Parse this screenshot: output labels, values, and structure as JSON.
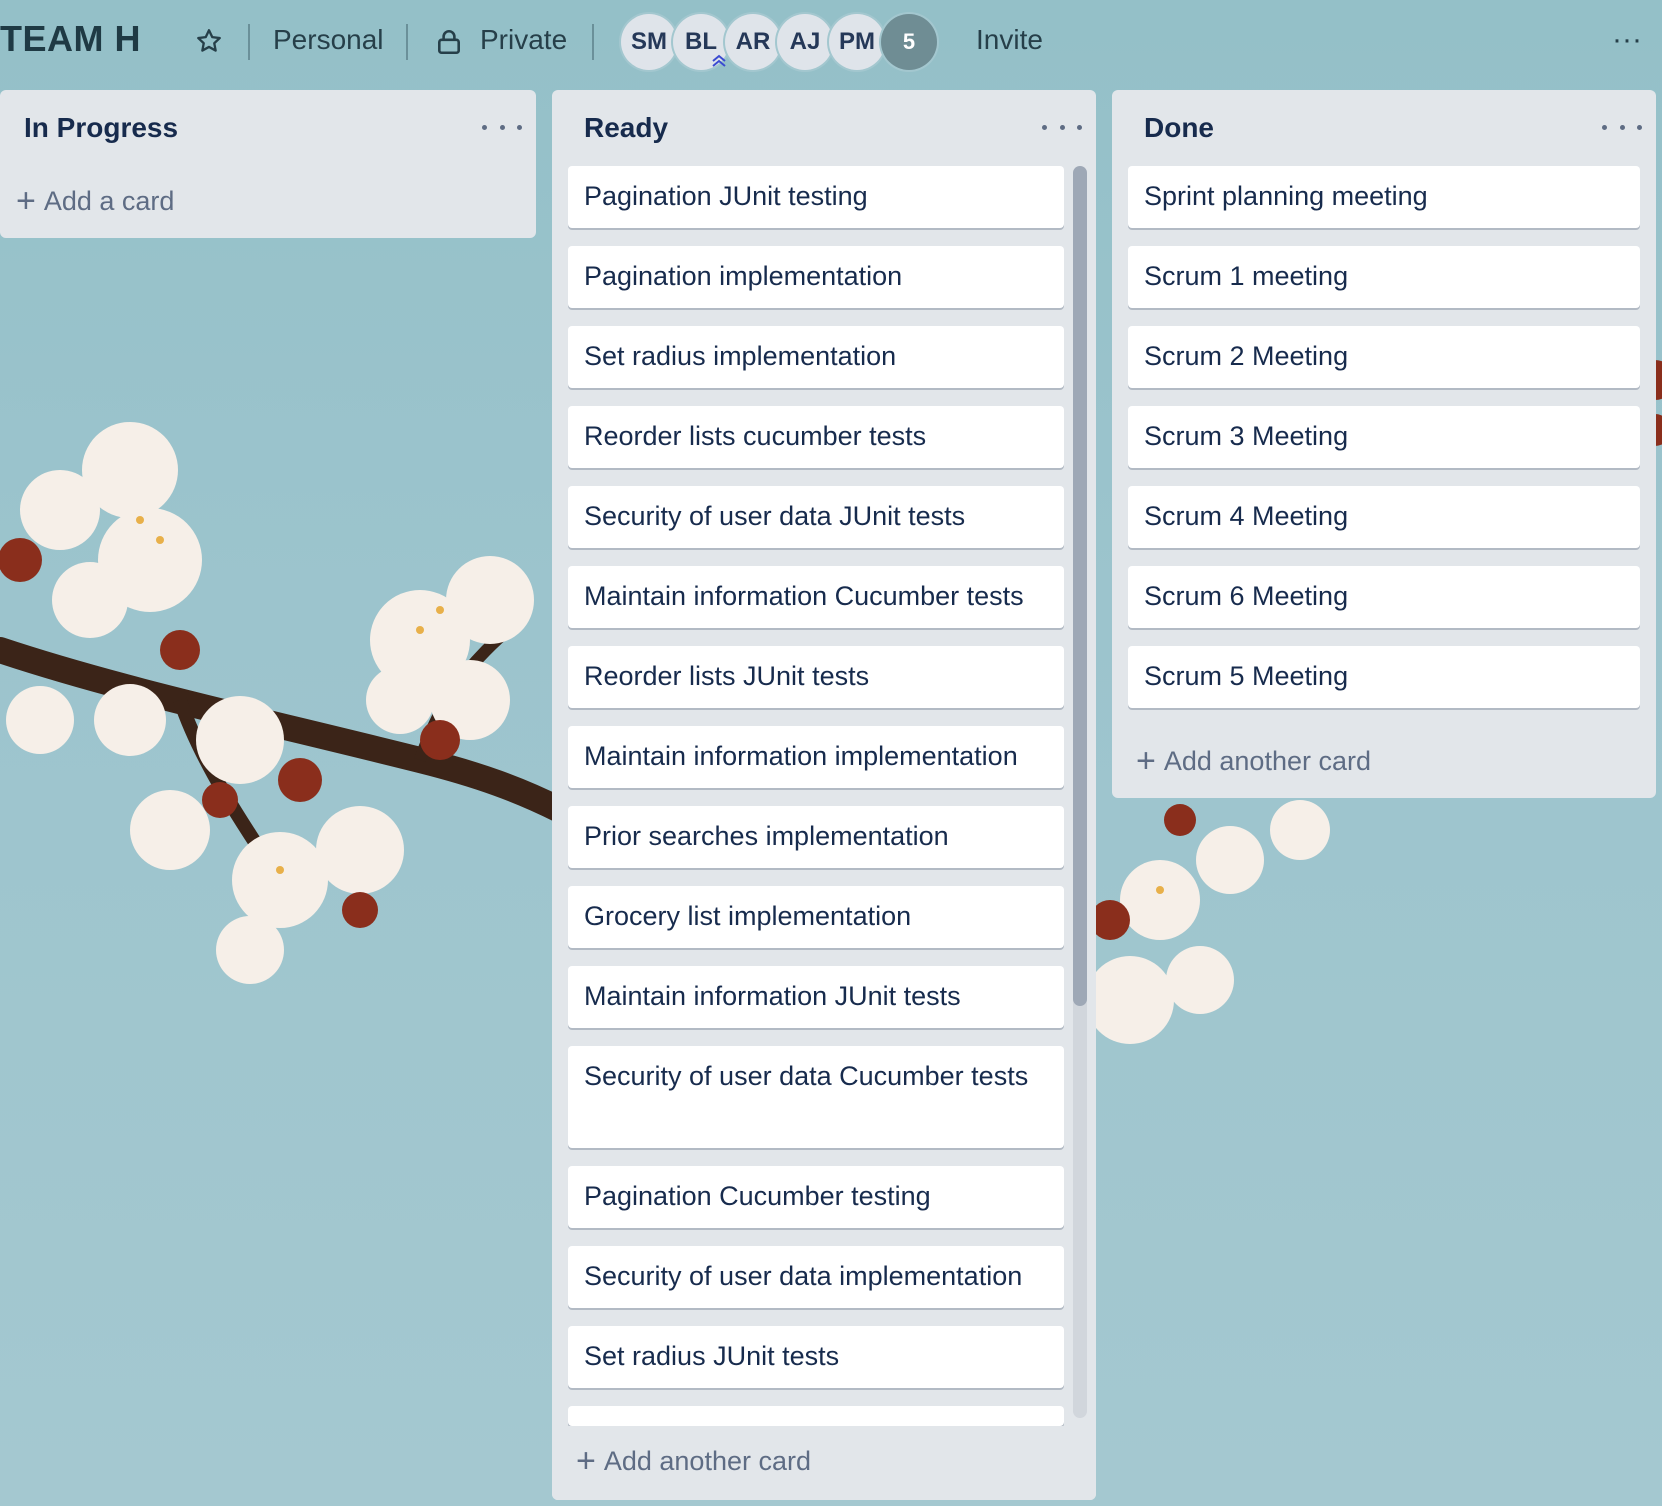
{
  "board": {
    "title": "TEAM H",
    "star_icon": "star-icon",
    "workspace": "Personal",
    "visibility": "Private",
    "visibility_icon": "lock-icon",
    "members": [
      "SM",
      "BL",
      "AR",
      "AJ",
      "PM"
    ],
    "more_members": "5",
    "invite_label": "Invite",
    "menu_label": "···"
  },
  "lists": {
    "in_progress": {
      "title": "In Progress",
      "add_label": "Add a card"
    },
    "ready": {
      "title": "Ready",
      "cards": [
        "Pagination JUnit testing",
        "Pagination implementation",
        "Set radius implementation",
        "Reorder lists cucumber tests",
        "Security of user data JUnit tests",
        "Maintain information Cucumber tests",
        "Reorder lists JUnit tests",
        "Maintain information implementation",
        "Prior searches implementation",
        "Grocery list implementation",
        "Maintain information JUnit tests",
        "Security of user data Cucumber tests",
        "Pagination Cucumber testing",
        "Security of user data implementation",
        "Set radius JUnit tests"
      ],
      "add_label": "Add another card"
    },
    "done": {
      "title": "Done",
      "cards": [
        "Sprint planning meeting",
        "Scrum 1 meeting",
        "Scrum 2 Meeting",
        "Scrum 3 Meeting",
        "Scrum 4 Meeting",
        "Scrum 6 Meeting",
        "Scrum 5 Meeting"
      ],
      "add_label": "Add another card"
    }
  },
  "colors": {
    "background": "#9cc4cd",
    "list_bg": "#e2e6ea",
    "card_bg": "#ffffff",
    "text": "#172b4d"
  }
}
